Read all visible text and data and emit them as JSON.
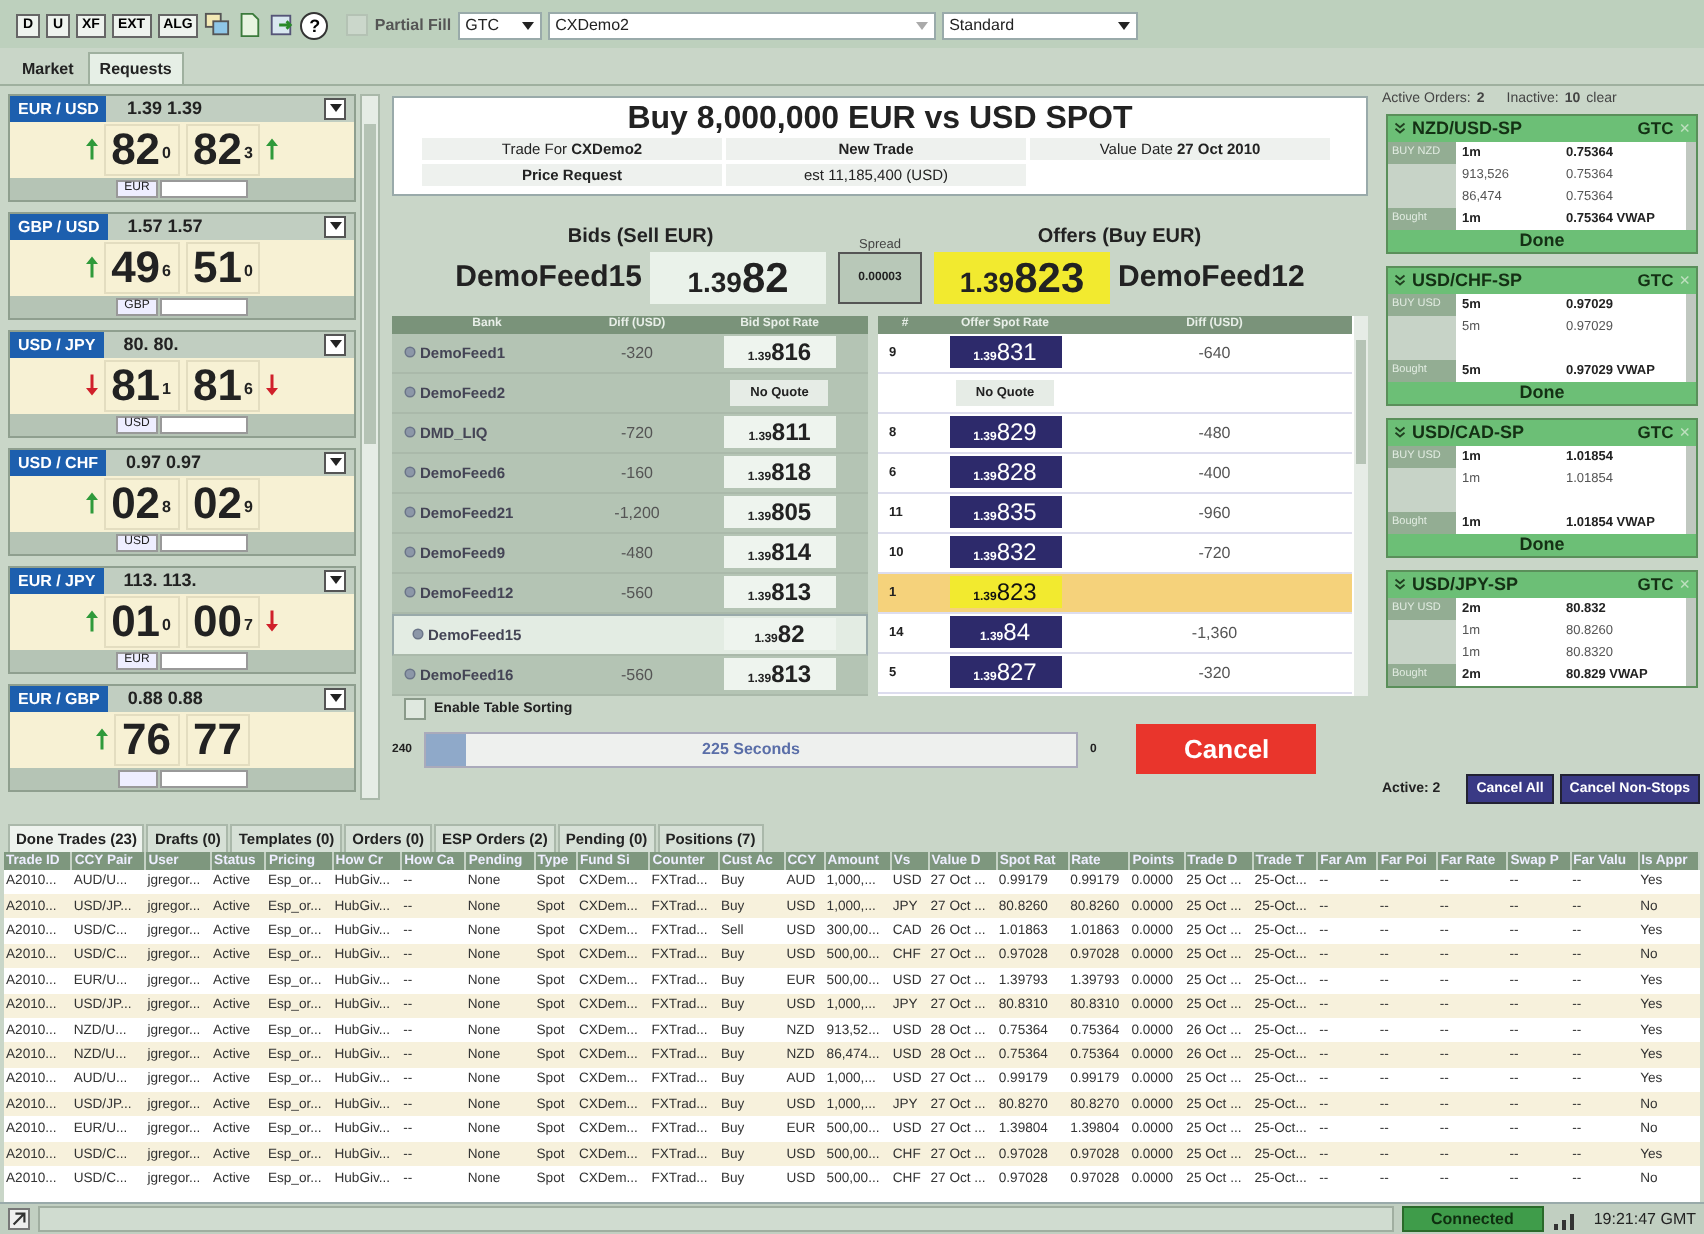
{
  "toolbar": {
    "buttons": [
      {
        "label": "D"
      },
      {
        "label": "U"
      },
      {
        "label": "XF"
      },
      {
        "label": "EXT"
      },
      {
        "label": "ALG"
      }
    ],
    "help": "?",
    "partial_fill": {
      "label": "Partial Fill",
      "checked": false,
      "disabled": true
    },
    "tif": "GTC",
    "account": "CXDemo2",
    "mode": "Standard"
  },
  "tabs": [
    {
      "label": "Market",
      "selected": false
    },
    {
      "label": "Requests",
      "selected": true
    }
  ],
  "tiles": [
    {
      "pair": "EUR / USD",
      "rates": "1.39 1.39",
      "bid": "82",
      "bid_pip": "0",
      "bid_arrow": {
        "kind": "up"
      },
      "ask": "82",
      "ask_pip": "3",
      "ask_arrow": {
        "kind": "up"
      },
      "ccy": "EUR"
    },
    {
      "pair": "GBP / USD",
      "rates": "1.57 1.57",
      "bid": "49",
      "bid_pip": "6",
      "bid_arrow": {
        "kind": "up"
      },
      "ask": "51",
      "ask_pip": "0",
      "ccy": "GBP"
    },
    {
      "pair": "USD / JPY",
      "rates": "80. 80.",
      "bid": "81",
      "bid_pip": "1",
      "bid_arrow": {
        "kind": "down"
      },
      "ask": "81",
      "ask_pip": "6",
      "ask_arrow": {
        "kind": "down"
      },
      "ccy": "USD"
    },
    {
      "pair": "USD / CHF",
      "rates": "0.97 0.97",
      "bid": "02",
      "bid_pip": "8",
      "bid_arrow": {
        "kind": "up"
      },
      "ask": "02",
      "ask_pip": "9",
      "ccy": "USD"
    },
    {
      "pair": "EUR / JPY",
      "rates": "113. 113.",
      "bid": "01",
      "bid_pip": "0",
      "bid_arrow": {
        "kind": "up"
      },
      "ask": "00",
      "ask_pip": "7",
      "ask_arrow": {
        "kind": "down"
      },
      "ccy": "EUR"
    },
    {
      "pair": "EUR / GBP",
      "rates": "0.88 0.88",
      "bid": "76",
      "bid_arrow": {
        "kind": "up"
      },
      "ask": "77"
    }
  ],
  "request": {
    "title": "Buy 8,000,000 EUR vs USD SPOT",
    "trade_for_label": "Trade For",
    "trade_for": "CXDemo2",
    "status": "New Trade",
    "value_date_label": "Value Date",
    "value_date": "27 Oct 2010",
    "request_type": "Price Request",
    "estimate": "est 11,185,400 (USD)"
  },
  "best": {
    "bids_label": "Bids (Sell EUR)",
    "bid_feed": "DemoFeed15",
    "bid_small": "1.39",
    "bid_big": "82",
    "spread_label": "Spread",
    "spread": "0.00003",
    "offers_label": "Offers (Buy EUR)",
    "offer_small": "1.39",
    "offer_big": "823",
    "offer_feed": "DemoFeed12"
  },
  "bid_columns": [
    "Bank",
    "Diff (USD)",
    "Bid Spot Rate"
  ],
  "offer_columns": [
    "#",
    "Offer Spot Rate",
    "Diff (USD)"
  ],
  "quotes": [
    {
      "bank": "DemoFeed1",
      "bid_diff": "-320",
      "bid": {
        "kind": "rate",
        "small": "1.39",
        "big": "816"
      },
      "bid_selected": false,
      "rank": "9",
      "offer": {
        "kind": "rate",
        "small": "1.39",
        "big": "831"
      },
      "offer_diff": "-640",
      "offer_selected": false
    },
    {
      "bank": "DemoFeed2",
      "bid": {
        "kind": "none",
        "text": "No Quote"
      },
      "bid_selected": false,
      "offer": {
        "kind": "none",
        "text": "No Quote"
      },
      "offer_selected": false
    },
    {
      "bank": "DMD_LIQ",
      "bid_diff": "-720",
      "bid": {
        "kind": "rate",
        "small": "1.39",
        "big": "811"
      },
      "bid_selected": false,
      "rank": "8",
      "offer": {
        "kind": "rate",
        "small": "1.39",
        "big": "829"
      },
      "offer_diff": "-480",
      "offer_selected": false
    },
    {
      "bank": "DemoFeed6",
      "bid_diff": "-160",
      "bid": {
        "kind": "rate",
        "small": "1.39",
        "big": "818"
      },
      "bid_selected": false,
      "rank": "6",
      "offer": {
        "kind": "rate",
        "small": "1.39",
        "big": "828"
      },
      "offer_diff": "-400",
      "offer_selected": false
    },
    {
      "bank": "DemoFeed21",
      "bid_diff": "-1,200",
      "bid": {
        "kind": "rate",
        "small": "1.39",
        "big": "805"
      },
      "bid_selected": false,
      "rank": "11",
      "offer": {
        "kind": "rate",
        "small": "1.39",
        "big": "835"
      },
      "offer_diff": "-960",
      "offer_selected": false
    },
    {
      "bank": "DemoFeed9",
      "bid_diff": "-480",
      "bid": {
        "kind": "rate",
        "small": "1.39",
        "big": "814"
      },
      "bid_selected": false,
      "rank": "10",
      "offer": {
        "kind": "rate",
        "small": "1.39",
        "big": "832"
      },
      "offer_diff": "-720",
      "offer_selected": false
    },
    {
      "bank": "DemoFeed12",
      "bid_diff": "-560",
      "bid": {
        "kind": "rate",
        "small": "1.39",
        "big": "813"
      },
      "bid_selected": false,
      "rank": "1",
      "offer": {
        "kind": "rate",
        "small": "1.39",
        "big": "823"
      },
      "offer_selected": true
    },
    {
      "bank": "DemoFeed15",
      "bid": {
        "kind": "rate",
        "small": "1.39",
        "big": "82"
      },
      "bid_selected": true,
      "rank": "14",
      "offer": {
        "kind": "rate",
        "small": "1.39",
        "big": "84"
      },
      "offer_diff": "-1,360",
      "offer_selected": false
    },
    {
      "bank": "DemoFeed16",
      "bid_diff": "-560",
      "bid": {
        "kind": "rate",
        "small": "1.39",
        "big": "813"
      },
      "bid_selected": false,
      "rank": "5",
      "offer": {
        "kind": "rate",
        "small": "1.39",
        "big": "827"
      },
      "offer_diff": "-320",
      "offer_selected": false
    }
  ],
  "sorting": {
    "label": "Enable Table Sorting",
    "checked": false
  },
  "timer": {
    "start": "240",
    "text": "225 Seconds",
    "end": "0",
    "level": 0.06
  },
  "cancel": "Cancel",
  "orders_summary": {
    "active_label": "Active Orders:",
    "active": "2",
    "inactive_label": "Inactive:",
    "inactive": "10",
    "clear": "clear"
  },
  "orders": [
    {
      "title": "NZD/USD-SP",
      "tif": "GTC",
      "close": "×",
      "side": "BUY NZD",
      "amount": "1m",
      "rate": "0.75364",
      "fills": [
        {
          "amount": "913,526",
          "rate": "0.75364"
        },
        {
          "amount": "86,474",
          "rate": "0.75364"
        }
      ],
      "result": "Bought",
      "result_amount": "1m",
      "result_rate": "0.75364 VWAP",
      "done": "Done"
    },
    {
      "title": "USD/CHF-SP",
      "tif": "GTC",
      "close": "×",
      "side": "BUY USD",
      "amount": "5m",
      "rate": "0.97029",
      "fills": [
        {
          "amount": "5m",
          "rate": "0.97029"
        }
      ],
      "result": "Bought",
      "result_amount": "5m",
      "result_rate": "0.97029 VWAP",
      "done": "Done"
    },
    {
      "title": "USD/CAD-SP",
      "tif": "GTC",
      "close": "×",
      "side": "BUY USD",
      "amount": "1m",
      "rate": "1.01854",
      "fills": [
        {
          "amount": "1m",
          "rate": "1.01854"
        }
      ],
      "result": "Bought",
      "result_amount": "1m",
      "result_rate": "1.01854 VWAP",
      "done": "Done"
    },
    {
      "title": "USD/JPY-SP",
      "tif": "GTC",
      "close": "×",
      "side": "BUY USD",
      "amount": "2m",
      "rate": "80.832",
      "fills": [
        {
          "amount": "1m",
          "rate": "80.8260"
        },
        {
          "amount": "1m",
          "rate": "80.8320"
        }
      ],
      "result": "Bought",
      "result_amount": "2m",
      "result_rate": "80.829 VWAP"
    }
  ],
  "orders_footer": {
    "active": "Active: 2",
    "cancel_all": "Cancel All",
    "cancel_non_stops": "Cancel Non-Stops"
  },
  "bottom_tabs": [
    {
      "label": "Done Trades (23)",
      "selected": true
    },
    {
      "label": "Drafts (0)",
      "selected": false
    },
    {
      "label": "Templates (0)",
      "selected": false
    },
    {
      "label": "Orders (0)",
      "selected": false
    },
    {
      "label": "ESP Orders (2)",
      "selected": false
    },
    {
      "label": "Pending (0)",
      "selected": false
    },
    {
      "label": "Positions (7)",
      "selected": false
    }
  ],
  "table": {
    "columns": [
      "Trade ID",
      "CCY Pair",
      "User",
      "Status",
      "Pricing",
      "How Cr",
      "How Ca",
      "Pending",
      "Type",
      "Fund Si",
      "Counter",
      "Cust Ac",
      "CCY",
      "Amount",
      "Vs",
      "Value D",
      "Spot Rat",
      "Rate",
      "Points",
      "Trade D",
      "Trade T",
      "Far Am",
      "Far Poi",
      "Far Rate",
      "Swap P",
      "Far Valu",
      "Is Appr"
    ],
    "rows": [
      [
        "A2010...",
        "AUD/U...",
        "jgregor...",
        "Active",
        "Esp_or...",
        "HubGiv...",
        "--",
        "None",
        "Spot",
        "CXDem...",
        "FXTrad...",
        "Buy",
        "AUD",
        "1,000,...",
        "USD",
        "27 Oct ...",
        "0.99179",
        "0.99179",
        "0.0000",
        "25 Oct ...",
        "25-Oct...",
        "--",
        "--",
        "--",
        "--",
        "--",
        "Yes"
      ],
      [
        "A2010...",
        "USD/JP...",
        "jgregor...",
        "Active",
        "Esp_or...",
        "HubGiv...",
        "--",
        "None",
        "Spot",
        "CXDem...",
        "FXTrad...",
        "Buy",
        "USD",
        "1,000,...",
        "JPY",
        "27 Oct ...",
        "80.8260",
        "80.8260",
        "0.0000",
        "25 Oct ...",
        "25-Oct...",
        "--",
        "--",
        "--",
        "--",
        "--",
        "No"
      ],
      [
        "A2010...",
        "USD/C...",
        "jgregor...",
        "Active",
        "Esp_or...",
        "HubGiv...",
        "--",
        "None",
        "Spot",
        "CXDem...",
        "FXTrad...",
        "Sell",
        "USD",
        "300,00...",
        "CAD",
        "26 Oct ...",
        "1.01863",
        "1.01863",
        "0.0000",
        "25 Oct ...",
        "25-Oct...",
        "--",
        "--",
        "--",
        "--",
        "--",
        "Yes"
      ],
      [
        "A2010...",
        "USD/C...",
        "jgregor...",
        "Active",
        "Esp_or...",
        "HubGiv...",
        "--",
        "None",
        "Spot",
        "CXDem...",
        "FXTrad...",
        "Buy",
        "USD",
        "500,00...",
        "CHF",
        "27 Oct ...",
        "0.97028",
        "0.97028",
        "0.0000",
        "25 Oct ...",
        "25-Oct...",
        "--",
        "--",
        "--",
        "--",
        "--",
        "No"
      ],
      [
        "A2010...",
        "EUR/U...",
        "jgregor...",
        "Active",
        "Esp_or...",
        "HubGiv...",
        "--",
        "None",
        "Spot",
        "CXDem...",
        "FXTrad...",
        "Buy",
        "EUR",
        "500,00...",
        "USD",
        "27 Oct ...",
        "1.39793",
        "1.39793",
        "0.0000",
        "25 Oct ...",
        "25-Oct...",
        "--",
        "--",
        "--",
        "--",
        "--",
        "Yes"
      ],
      [
        "A2010...",
        "USD/JP...",
        "jgregor...",
        "Active",
        "Esp_or...",
        "HubGiv...",
        "--",
        "None",
        "Spot",
        "CXDem...",
        "FXTrad...",
        "Buy",
        "USD",
        "1,000,...",
        "JPY",
        "27 Oct ...",
        "80.8310",
        "80.8310",
        "0.0000",
        "25 Oct ...",
        "25-Oct...",
        "--",
        "--",
        "--",
        "--",
        "--",
        "Yes"
      ],
      [
        "A2010...",
        "NZD/U...",
        "jgregor...",
        "Active",
        "Esp_or...",
        "HubGiv...",
        "--",
        "None",
        "Spot",
        "CXDem...",
        "FXTrad...",
        "Buy",
        "NZD",
        "913,52...",
        "USD",
        "28 Oct ...",
        "0.75364",
        "0.75364",
        "0.0000",
        "26 Oct ...",
        "25-Oct...",
        "--",
        "--",
        "--",
        "--",
        "--",
        "Yes"
      ],
      [
        "A2010...",
        "NZD/U...",
        "jgregor...",
        "Active",
        "Esp_or...",
        "HubGiv...",
        "--",
        "None",
        "Spot",
        "CXDem...",
        "FXTrad...",
        "Buy",
        "NZD",
        "86,474...",
        "USD",
        "28 Oct ...",
        "0.75364",
        "0.75364",
        "0.0000",
        "26 Oct ...",
        "25-Oct...",
        "--",
        "--",
        "--",
        "--",
        "--",
        "Yes"
      ],
      [
        "A2010...",
        "AUD/U...",
        "jgregor...",
        "Active",
        "Esp_or...",
        "HubGiv...",
        "--",
        "None",
        "Spot",
        "CXDem...",
        "FXTrad...",
        "Buy",
        "AUD",
        "1,000,...",
        "USD",
        "27 Oct ...",
        "0.99179",
        "0.99179",
        "0.0000",
        "25 Oct ...",
        "25-Oct...",
        "--",
        "--",
        "--",
        "--",
        "--",
        "Yes"
      ],
      [
        "A2010...",
        "USD/JP...",
        "jgregor...",
        "Active",
        "Esp_or...",
        "HubGiv...",
        "--",
        "None",
        "Spot",
        "CXDem...",
        "FXTrad...",
        "Buy",
        "USD",
        "1,000,...",
        "JPY",
        "27 Oct ...",
        "80.8270",
        "80.8270",
        "0.0000",
        "25 Oct ...",
        "25-Oct...",
        "--",
        "--",
        "--",
        "--",
        "--",
        "No"
      ],
      [
        "A2010...",
        "EUR/U...",
        "jgregor...",
        "Active",
        "Esp_or...",
        "HubGiv...",
        "--",
        "None",
        "Spot",
        "CXDem...",
        "FXTrad...",
        "Buy",
        "EUR",
        "500,00...",
        "USD",
        "27 Oct ...",
        "1.39804",
        "1.39804",
        "0.0000",
        "25 Oct ...",
        "25-Oct...",
        "--",
        "--",
        "--",
        "--",
        "--",
        "No"
      ],
      [
        "A2010...",
        "USD/C...",
        "jgregor...",
        "Active",
        "Esp_or...",
        "HubGiv...",
        "--",
        "None",
        "Spot",
        "CXDem...",
        "FXTrad...",
        "Buy",
        "USD",
        "500,00...",
        "CHF",
        "27 Oct ...",
        "0.97028",
        "0.97028",
        "0.0000",
        "25 Oct ...",
        "25-Oct...",
        "--",
        "--",
        "--",
        "--",
        "--",
        "Yes"
      ],
      [
        "A2010...",
        "USD/C...",
        "jgregor...",
        "Active",
        "Esp_or...",
        "HubGiv...",
        "--",
        "None",
        "Spot",
        "CXDem...",
        "FXTrad...",
        "Buy",
        "USD",
        "500,00...",
        "CHF",
        "27 Oct ...",
        "0.97028",
        "0.97028",
        "0.0000",
        "25 Oct ...",
        "25-Oct...",
        "--",
        "--",
        "--",
        "--",
        "--",
        "No"
      ]
    ]
  },
  "status_bar": {
    "connection": "Connected",
    "time": "19:21:47 GMT"
  }
}
